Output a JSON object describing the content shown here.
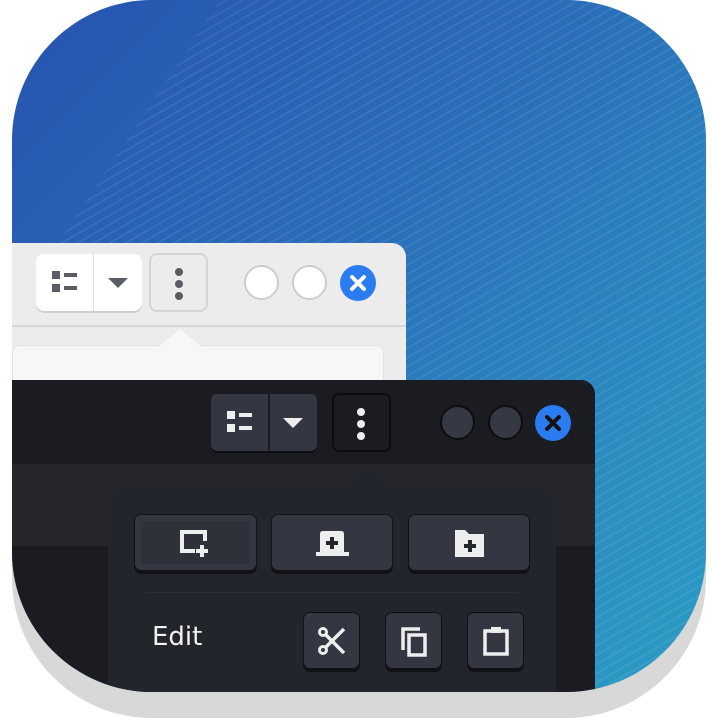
{
  "popover": {
    "section_label": "Edit"
  },
  "colors": {
    "accent": "#2b7cf0",
    "light_window": "#ececec",
    "dark_window": "#1b1c21"
  },
  "icons": [
    "list-view-icon",
    "chevron-down-icon",
    "kebab-menu-icon",
    "minimize-icon",
    "maximize-icon",
    "close-icon",
    "new-window-icon",
    "new-tab-icon",
    "new-folder-icon",
    "cut-icon",
    "copy-icon",
    "paste-icon"
  ]
}
